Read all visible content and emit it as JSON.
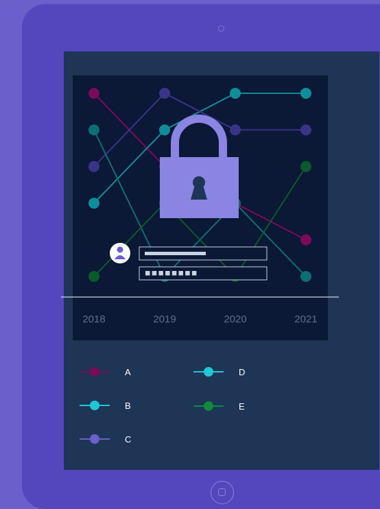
{
  "chart_data": {
    "type": "line",
    "categories": [
      "2018",
      "2019",
      "2020",
      "2021"
    ],
    "series": [
      {
        "name": "A",
        "color": "#7a0a5c",
        "values": [
          5,
          3,
          2,
          1
        ]
      },
      {
        "name": "B",
        "color": "#0e8e9a",
        "values": [
          2,
          4,
          5,
          5
        ]
      },
      {
        "name": "C",
        "color": "#3a3488",
        "values": [
          3,
          5,
          4,
          4
        ]
      },
      {
        "name": "D",
        "color": "#0e6e76",
        "values": [
          4,
          0,
          2,
          0
        ]
      },
      {
        "name": "E",
        "color": "#0b5a2c",
        "values": [
          0,
          2,
          0,
          3
        ]
      }
    ],
    "legend_colors": {
      "A": "#7a0a5c",
      "B": "#1fc8d4",
      "C": "#6a5fcb",
      "D": "#1fc8d4",
      "E": "#0f8b3e"
    },
    "ylim": [
      0,
      5
    ],
    "grid": false,
    "legend_position": "bottom"
  },
  "icons": [
    "padlock-icon",
    "user-avatar-icon",
    "camera-icon",
    "home-button-icon"
  ],
  "colors": {
    "frame": "#5447bd",
    "screen": "#1e3556",
    "plot": "#0b1836",
    "lock": "#8a84e2"
  }
}
